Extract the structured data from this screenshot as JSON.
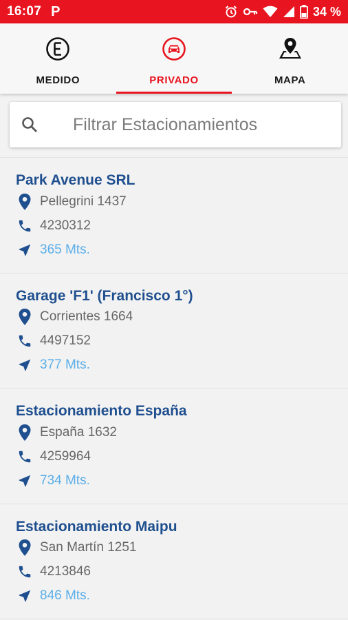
{
  "status_bar": {
    "time": "16:07",
    "app_icon": "P",
    "battery": "34 %",
    "icons": [
      "alarm-icon",
      "key-icon",
      "wifi-icon",
      "signal-icon",
      "battery-icon"
    ],
    "color": "#e8141f"
  },
  "tabs": [
    {
      "label": "MEDIDO",
      "icon": "meter-e-icon",
      "active": false
    },
    {
      "label": "PRIVADO",
      "icon": "car-icon",
      "active": true
    },
    {
      "label": "MAPA",
      "icon": "map-pin-icon",
      "active": false
    }
  ],
  "search": {
    "placeholder": "Filtrar Estacionamientos",
    "value": ""
  },
  "parkings": [
    {
      "name": "Park Avenue SRL",
      "address": "Pellegrini 1437",
      "phone": "4230312",
      "distance": "365 Mts."
    },
    {
      "name": "Garage 'F1' (Francisco 1°)",
      "address": "Corrientes 1664",
      "phone": "4497152",
      "distance": "377 Mts."
    },
    {
      "name": "Estacionamiento España",
      "address": "España 1632",
      "phone": "4259964",
      "distance": "734 Mts."
    },
    {
      "name": "Estacionamiento Maipu",
      "address": "San Martín 1251",
      "phone": "4213846",
      "distance": "846 Mts."
    }
  ],
  "colors": {
    "accent": "#e8141f",
    "title": "#1f4f8f",
    "distance": "#5aaee8",
    "icon": "#1f4f8f"
  }
}
